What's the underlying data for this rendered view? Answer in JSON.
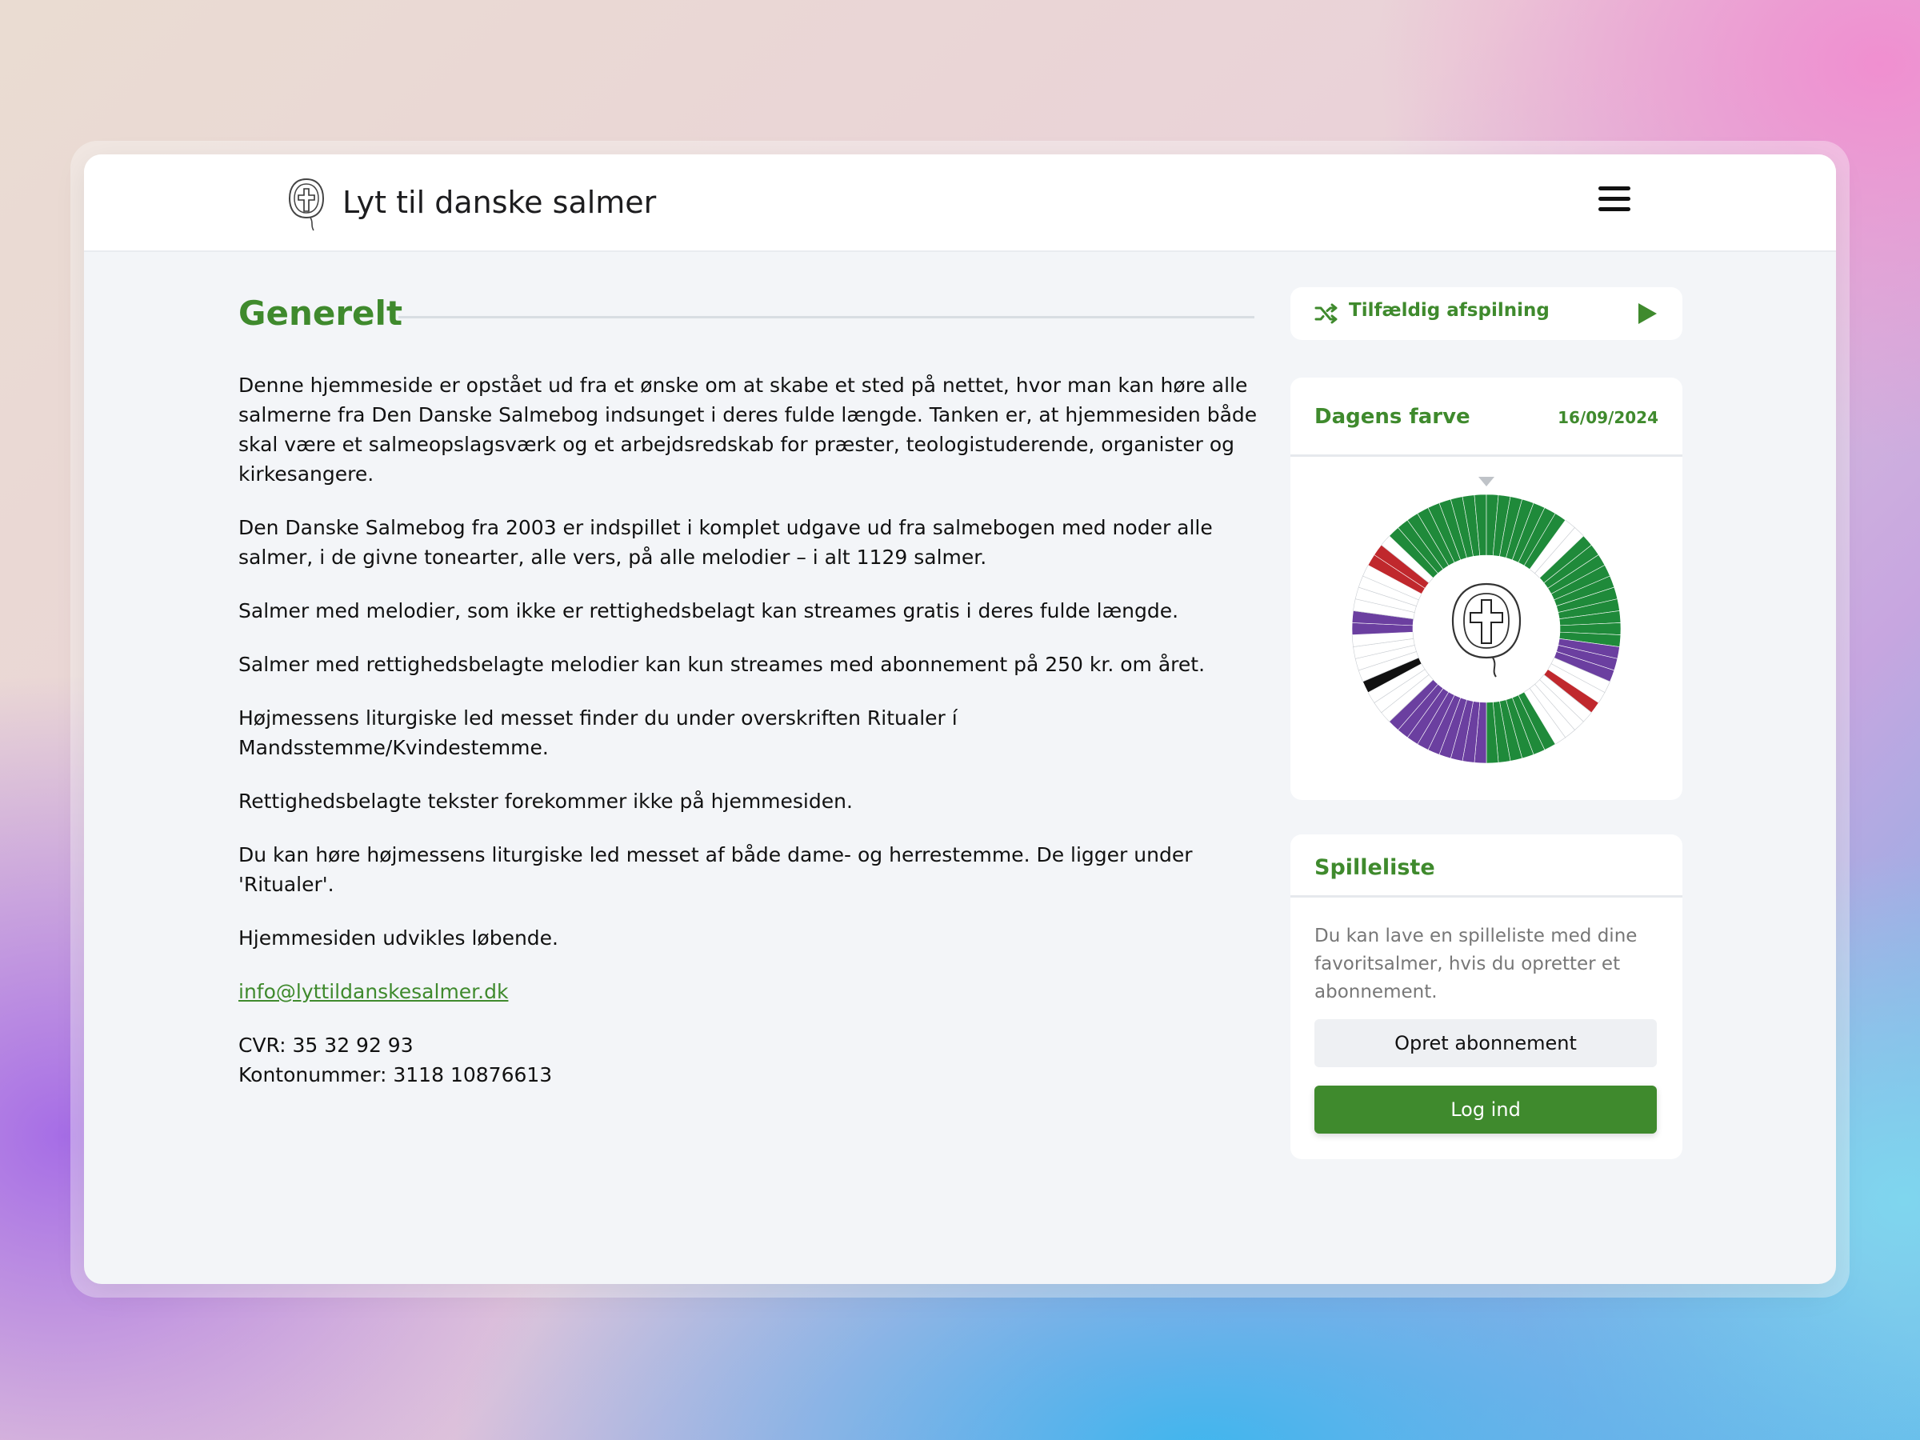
{
  "header": {
    "brand_title": "Lyt til danske salmer"
  },
  "main": {
    "section_title": "Generelt",
    "paragraphs": [
      "Denne hjemmeside er opstået ud fra et ønske om at skabe et sted på nettet, hvor man kan høre alle salmerne fra Den Danske Salmebog indsunget i deres fulde længde. Tanken er, at hjemmesiden både skal være et salmeopslagsværk og et arbejdsredskab for præster, teologistuderende, organister og kirkesangere.",
      "Den Danske Salmebog fra 2003 er indspillet i komplet udgave ud fra salmebogen med noder alle salmer, i de givne tonearter, alle vers, på alle melodier – i alt 1129 salmer.",
      "Salmer med melodier, som ikke er rettighedsbelagt kan streames gratis i deres fulde længde.",
      "Salmer med rettighedsbelagte melodier kan kun streames med abonnement på 250 kr. om året.",
      "Højmessens liturgiske led messet finder du under overskriften Ritualer í Mandsstemme/Kvindestemme.",
      "Rettighedsbelagte tekster forekommer ikke på hjemmesiden.",
      "Du kan høre højmessens liturgiske led messet af både dame- og herrestemme. De ligger under 'Ritualer'.",
      "Hjemmesiden udvikles løbende."
    ],
    "email": "info@lyttildanskesalmer.dk",
    "cvr": "CVR: 35 32 92 93",
    "account": "Kontonummer: 3118 10876613"
  },
  "sidebar": {
    "random_play_label": "Tilfældig afspilning",
    "colors": {
      "accent": "#3f8a2d",
      "liturgical_green": "#1f8a3a",
      "liturgical_purple": "#6b3fa0",
      "liturgical_red": "#c0282d",
      "liturgical_white": "#ffffff",
      "liturgical_black": "#111111"
    },
    "day_color": {
      "title": "Dagens farve",
      "date": "16/09/2024"
    },
    "playlist": {
      "title": "Spilleliste",
      "description": "Du kan lave en spilleliste med dine favoritsalmer, hvis du opretter et abonnement.",
      "subscribe_label": "Opret abonnement",
      "login_label": "Log ind"
    }
  }
}
